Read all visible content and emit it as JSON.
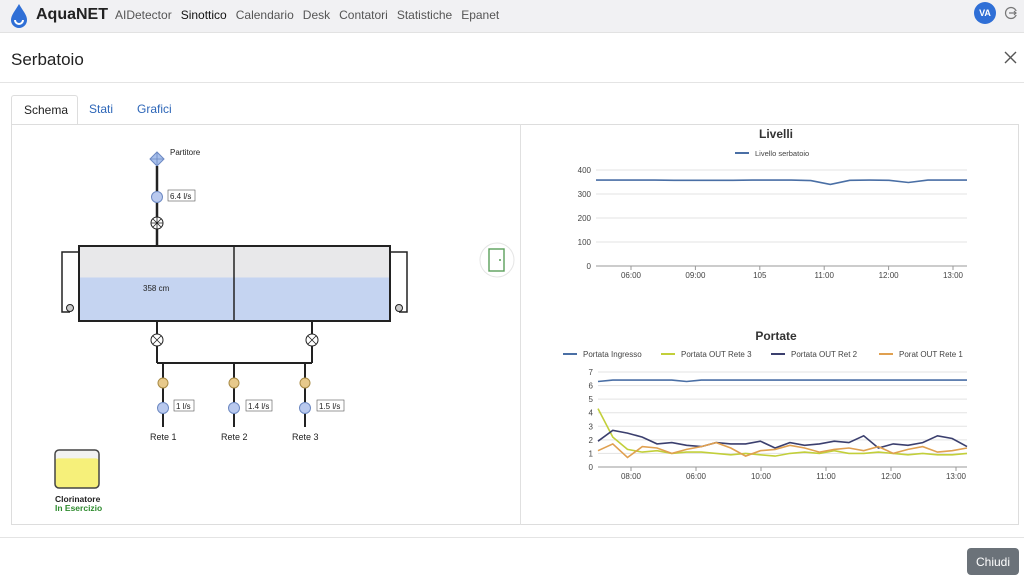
{
  "app": {
    "name": "AquaNET",
    "user_initials": "VA"
  },
  "nav": {
    "items": [
      {
        "label": "AIDetector",
        "active": false
      },
      {
        "label": "Sinottico",
        "active": true
      },
      {
        "label": "Calendario",
        "active": false
      },
      {
        "label": "Desk",
        "active": false
      },
      {
        "label": "Contatori",
        "active": false
      },
      {
        "label": "Statistiche",
        "active": false
      },
      {
        "label": "Epanet",
        "active": false
      }
    ]
  },
  "modal": {
    "title": "Serbatoio",
    "close_label": "Chiudi",
    "tabs": [
      {
        "label": "Schema",
        "active": true
      },
      {
        "label": "Stati",
        "active": false
      },
      {
        "label": "Grafici",
        "active": false
      }
    ]
  },
  "schema": {
    "inlet": {
      "label": "Partitore",
      "flow": "6.4 l/s"
    },
    "tank": {
      "level": "358 cm",
      "fill_fraction": 0.58
    },
    "outlets": [
      {
        "name": "Rete 1",
        "flow": "1 l/s"
      },
      {
        "name": "Rete 2",
        "flow": "1.4 l/s"
      },
      {
        "name": "Rete 3",
        "flow": "1.5 l/s"
      }
    ],
    "chlorinator": {
      "label": "Clorinatore",
      "status": "In Esercizio",
      "fill_fraction": 0.78
    }
  },
  "chart_data": [
    {
      "type": "line",
      "title": "Livelli",
      "x": [
        "05:00",
        "05:30",
        "06:00",
        "06:30",
        "07:00",
        "07:30",
        "08:00",
        "08:30",
        "09:00",
        "09:30",
        "10:00",
        "10:30",
        "11:00",
        "11:30",
        "12:00",
        "12:30",
        "13:00",
        "13:30"
      ],
      "x_tick_labels": [
        "06:00",
        "09:00",
        "105",
        "11:00",
        "12:00",
        "13:00"
      ],
      "series": [
        {
          "name": "Livello serbatoio",
          "color": "#4a6fa5",
          "values": [
            358,
            358,
            358,
            358,
            357,
            357,
            357,
            357,
            358,
            358,
            358,
            356,
            340,
            357,
            358,
            357,
            348,
            358,
            358,
            358
          ]
        }
      ],
      "ylim": [
        0,
        400
      ],
      "y_ticks": [
        0,
        100,
        200,
        300,
        400
      ],
      "grid": true,
      "legend": "top"
    },
    {
      "type": "line",
      "title": "Portate",
      "x_tick_labels": [
        "08:00",
        "06:00",
        "10:00",
        "11:00",
        "12:00",
        "13:00"
      ],
      "series": [
        {
          "name": "Portata Ingresso",
          "color": "#4a6fa5",
          "values": [
            6.3,
            6.4,
            6.4,
            6.4,
            6.4,
            6.4,
            6.3,
            6.4,
            6.4,
            6.4,
            6.4,
            6.4,
            6.4,
            6.4,
            6.4,
            6.4,
            6.4,
            6.4,
            6.4,
            6.4,
            6.4,
            6.4,
            6.4,
            6.4,
            6.4,
            6.4
          ]
        },
        {
          "name": "Portata OUT Rete 3",
          "color": "#c2cf3a",
          "values": [
            4.3,
            2.2,
            1.3,
            1.1,
            1.2,
            1.0,
            1.1,
            1.1,
            1.0,
            0.9,
            1.0,
            0.9,
            0.8,
            1.0,
            1.1,
            1.0,
            1.2,
            1.0,
            1.0,
            1.1,
            1.0,
            0.9,
            1.0,
            0.9,
            0.9,
            1.0
          ]
        },
        {
          "name": "Portata OUT Ret 2",
          "color": "#3b3f6e",
          "values": [
            1.9,
            2.7,
            2.5,
            2.2,
            1.7,
            1.8,
            1.6,
            1.5,
            1.8,
            1.7,
            1.7,
            1.9,
            1.4,
            1.8,
            1.6,
            1.7,
            1.9,
            1.8,
            2.3,
            1.4,
            1.7,
            1.6,
            1.8,
            2.3,
            2.1,
            1.5
          ]
        },
        {
          "name": "Porat OUT Rete 1",
          "color": "#e0a050",
          "values": [
            1.2,
            1.7,
            0.7,
            1.5,
            1.4,
            1.0,
            1.3,
            1.5,
            1.8,
            1.4,
            0.8,
            1.2,
            1.3,
            1.6,
            1.4,
            1.1,
            1.3,
            1.4,
            1.2,
            1.5,
            1.0,
            1.3,
            1.5,
            1.1,
            1.2,
            1.4
          ]
        }
      ],
      "ylim": [
        0,
        7
      ],
      "y_ticks": [
        0,
        1,
        2,
        3,
        4,
        5,
        6,
        7
      ],
      "grid": true,
      "legend": "top"
    }
  ],
  "colors": {
    "accent": "#2f6fd6",
    "water": "#c5d4f1",
    "chlorine": "#f6f07a",
    "status_ok": "#2e8b2e"
  }
}
